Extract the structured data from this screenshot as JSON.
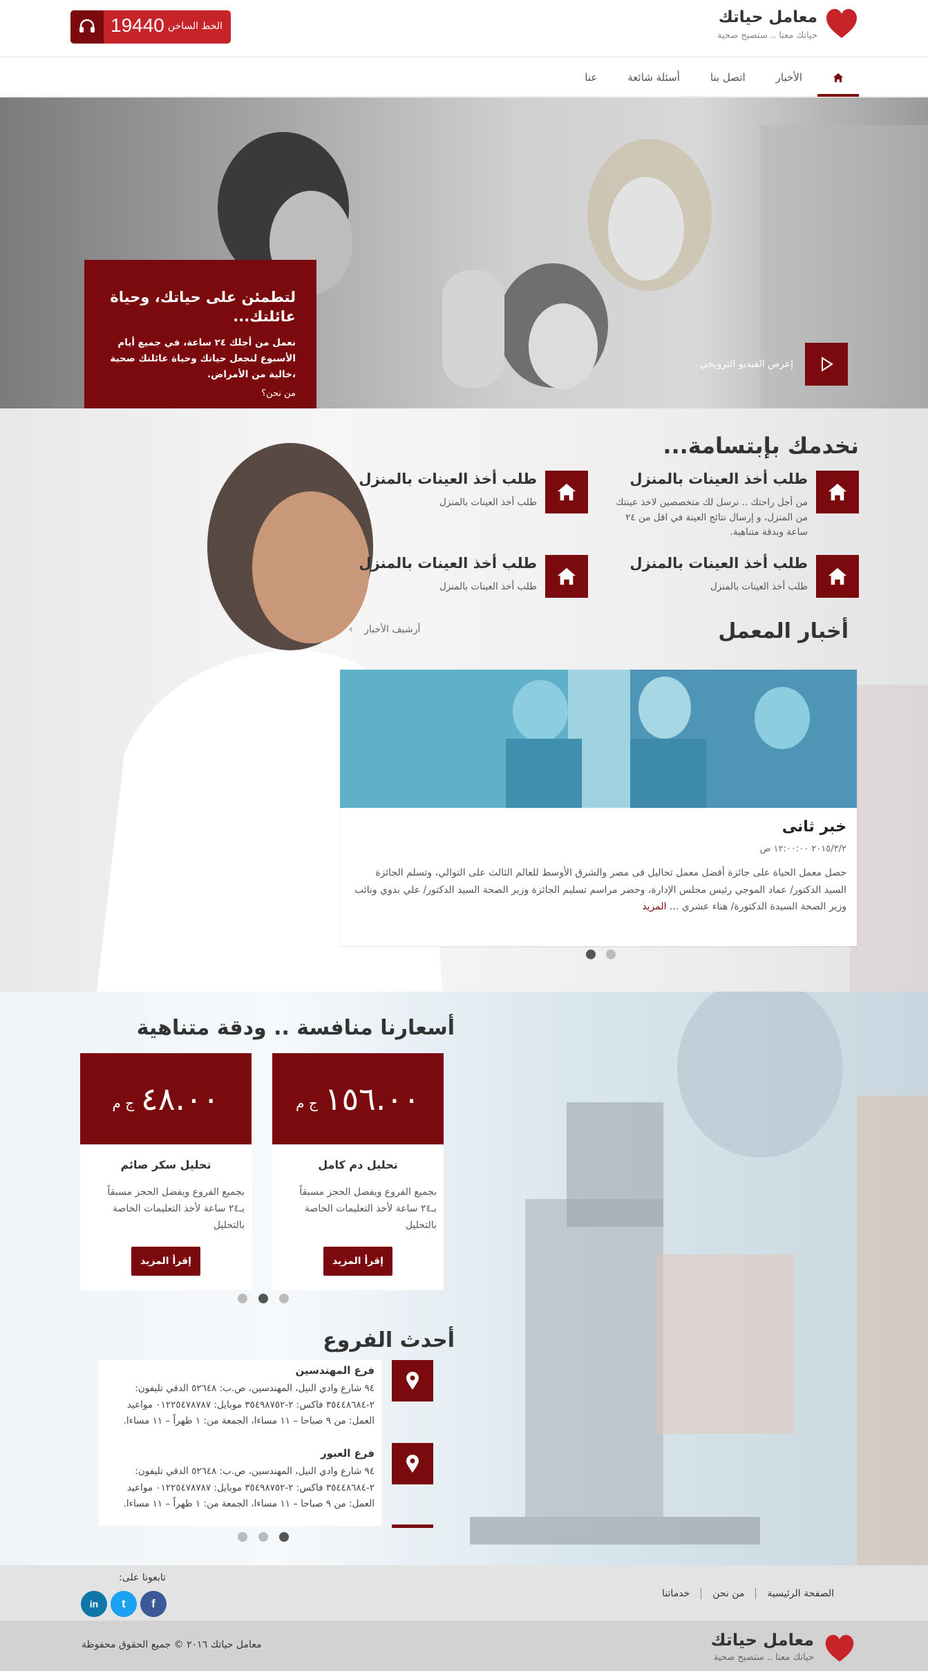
{
  "colors": {
    "brand": "#7a0a0d",
    "accent": "#c7242a",
    "facebook": "#3b5998",
    "twitter": "#1da1f2",
    "linkedin": "#0e76a8"
  },
  "header": {
    "logo_title": "معامل حياتك",
    "logo_tagline": "حياتك معنا .. ستصبح صحية",
    "hotline_label": "الخط الساخن",
    "hotline_number": "19440",
    "hotline_icon": "headset-icon"
  },
  "nav": {
    "home_icon": "home-icon",
    "items": [
      "الأخبار",
      "اتصل بنا",
      "أسئلة شائعة",
      "عنا"
    ]
  },
  "hero": {
    "title": "لتطمئن على حياتك، وحياة عائلتك...",
    "text": "نعمل من أجلك ٢٤ ساعة، في جميع أيام الأسبوع لنجعل حياتك وحياة عائلتك صحية ،خالية من الأمراض.",
    "link": "من نحن؟",
    "video_label": "إعرض الفيديو الترويجي"
  },
  "services": {
    "title": "نخدمك بإبتسامة...",
    "items": [
      {
        "title": "طلب أخذ العينات بالمنزل",
        "desc": "من أجل راحتك .. نرسل لك متخصصين لاخذ عينتك من المنزل، و إرسال نتائج العينة في اقل من ٢٤ ساعة وبدقة متناهية."
      },
      {
        "title": "طلب أخذ العينات بالمنزل",
        "desc": "طلب أخذ العينات بالمنزل"
      },
      {
        "title": "طلب أخذ العينات بالمنزل",
        "desc": "طلب أخذ العينات بالمنزل"
      },
      {
        "title": "طلب أخذ العينات بالمنزل",
        "desc": "طلب أخذ العينات بالمنزل"
      }
    ]
  },
  "news": {
    "title": "أخبار المعمل",
    "archive": "أرشيف الأخبار",
    "headline": "خبر ثانى",
    "date": "٢٠١٥/٣/٢ ١٢:٠٠:٠٠ ص",
    "body": "حصل معمل الحياة على جائزة أفضل معمل تحاليل فى مصر والشرق الأوسط للعالم الثالث على التوالي، وتسلم الجائزة السيد الدكتور/ عماد الموجي رئيس مجلس الإدارة، وحضر مراسم تسليم الجائزة وزير الصحة السيد الدكتور/ علي بدوي ونائب وزير الصحة السيدة الدكتورة/ هناء عشري ... ",
    "more": "المزيد"
  },
  "prices": {
    "title": "أسعارنا منافسة .. ودقة متناهية",
    "currency": "ج م",
    "button": "إقرأ المزيد",
    "items": [
      {
        "value": "١٥٦.٠٠",
        "name": "تحليل دم كامل",
        "desc": "بجميع الفروع ويفضل الحجز مسبقاً بـ٢٤ ساعة لأخذ التعليمات الخاصة بالتحليل"
      },
      {
        "value": "٤٨.٠٠",
        "name": "تحليل سكر صائم",
        "desc": "بجميع الفروع ويفضل الحجز مسبقاً بـ٢٤ ساعة لأخذ التعليمات الخاصة بالتحليل"
      }
    ]
  },
  "branches": {
    "title": "أحدث الفروع",
    "items": [
      {
        "name": "فرع المهندسين",
        "address": "٩٤ شارع وادي النيل، المهندسين، ص.ب: ٥٢٦٤٨ الدقي تليفون: ٢-٣٥٤٤٨٦٨٤ فاكس: ٢-٣٥٤٩٨٧٥٢ موبايل: ٠١٢٢٥٤٧٨٧٨٧ مواعيد العمل: من ٩ صباحا – ١١ مساءا، الجمعة من: ١ ظهراً – ١١ مساءا."
      },
      {
        "name": "فرع العبور",
        "address": "٩٤ شارع وادي النيل، المهندسين، ص.ب: ٥٢٦٤٨ الدقي تليفون: ٢-٣٥٤٤٨٦٨٤ فاكس: ٢-٣٥٤٩٨٧٥٢ موبايل: ٠١٢٢٥٤٧٨٧٨٧ مواعيد العمل: من ٩ صباحا – ١١ مساءا، الجمعة من: ١ ظهراً – ١١ مساءا."
      }
    ]
  },
  "footer": {
    "links": [
      "الصفحة الرئيسية",
      "من نحن",
      "خدماتنا"
    ],
    "follow": "تابعونا على:",
    "social": [
      {
        "icon": "facebook-icon",
        "glyph": "f"
      },
      {
        "icon": "twitter-icon",
        "glyph": "t"
      },
      {
        "icon": "linkedin-icon",
        "glyph": "in"
      }
    ],
    "logo_title": "معامل حياتك",
    "logo_tagline": "حياتك معنا .. ستصبح صحية",
    "copyright": "معامل حياتك ٢٠١٦ © جميع الحقوق محفوظة"
  }
}
